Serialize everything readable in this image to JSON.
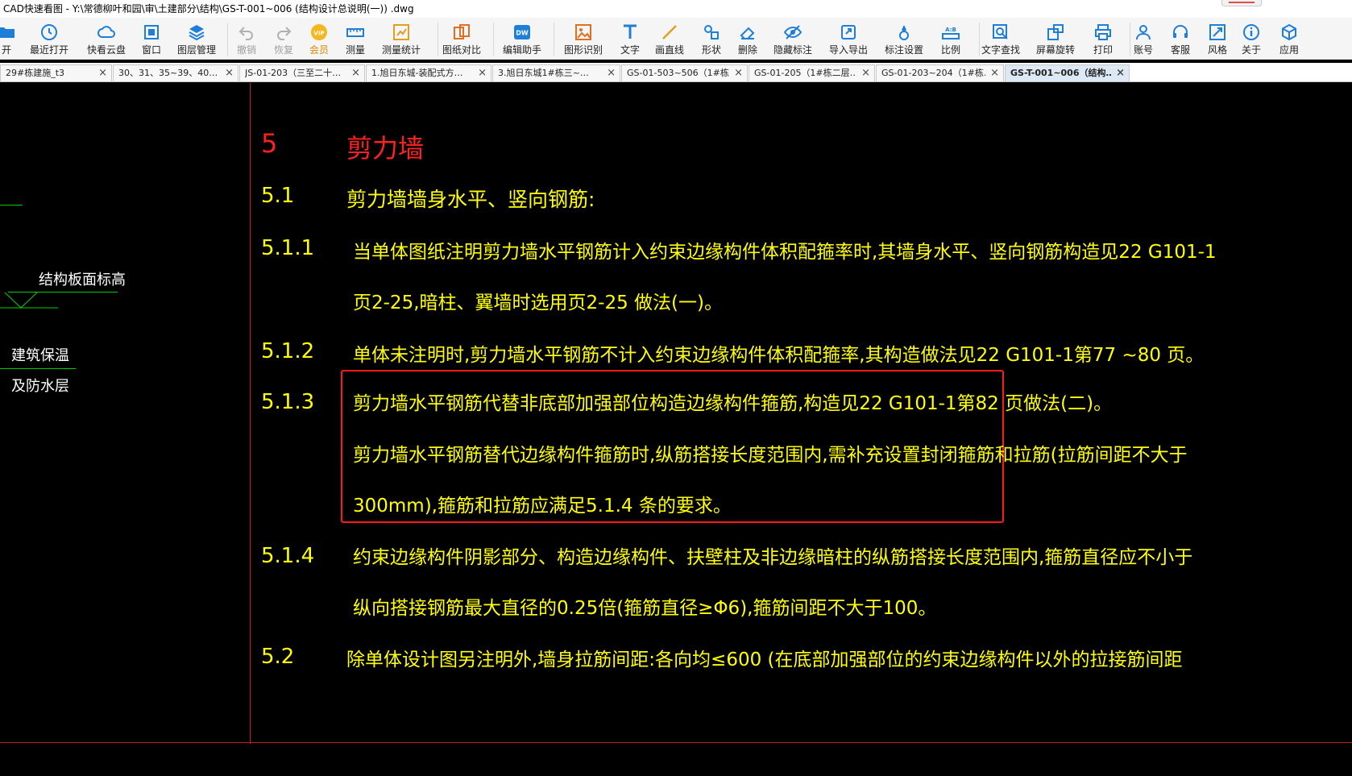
{
  "window": {
    "title": "CAD快速看图 - Y:\\常德柳叶和园\\审\\土建部分\\结构\\GS-T-001~006 (结构设计总说明(一)) .dwg"
  },
  "toolbar": {
    "items": [
      {
        "label": "开",
        "icon": "folder-open-icon"
      },
      {
        "label": "最近打开",
        "icon": "recent-clock-icon"
      },
      {
        "label": "快看云盘",
        "icon": "cloud-icon"
      },
      {
        "label": "窗口",
        "icon": "window-icon"
      },
      {
        "label": "图层管理",
        "icon": "layers-icon"
      },
      {
        "label": "撤销",
        "icon": "undo-icon"
      },
      {
        "label": "恢复",
        "icon": "redo-icon"
      },
      {
        "label": "会员",
        "icon": "vip-icon",
        "badge": "VIP"
      },
      {
        "label": "测量",
        "icon": "ruler-icon"
      },
      {
        "label": "测量统计",
        "icon": "measure-stats-icon"
      },
      {
        "label": "图纸对比",
        "icon": "compare-icon"
      },
      {
        "label": "编辑助手",
        "icon": "edit-assistant-icon",
        "badge": "DW"
      },
      {
        "label": "图形识别",
        "icon": "shape-recognition-icon"
      },
      {
        "label": "文字",
        "icon": "text-icon"
      },
      {
        "label": "画直线",
        "icon": "line-icon"
      },
      {
        "label": "形状",
        "icon": "shapes-icon"
      },
      {
        "label": "删除",
        "icon": "eraser-icon"
      },
      {
        "label": "隐藏标注",
        "icon": "hide-eye-icon"
      },
      {
        "label": "导入导出",
        "icon": "import-export-icon"
      },
      {
        "label": "标注设置",
        "icon": "annotation-settings-icon"
      },
      {
        "label": "比例",
        "icon": "scale-icon",
        "badge": "A:B"
      },
      {
        "label": "文字查找",
        "icon": "text-search-icon"
      },
      {
        "label": "屏幕旋转",
        "icon": "rotate-screen-icon"
      },
      {
        "label": "打印",
        "icon": "printer-icon"
      },
      {
        "label": "账号",
        "icon": "user-icon"
      },
      {
        "label": "客服",
        "icon": "headset-icon"
      },
      {
        "label": "风格",
        "icon": "style-icon"
      },
      {
        "label": "关于",
        "icon": "info-icon"
      },
      {
        "label": "应用",
        "icon": "apps-cube-icon"
      }
    ]
  },
  "tabs": [
    {
      "label": "29#栋建施_t3",
      "active": false
    },
    {
      "label": "30、31、35~39、40…",
      "active": false
    },
    {
      "label": "JS-01-203（三至二十…",
      "active": false
    },
    {
      "label": "1.旭日东城-装配式方…",
      "active": false
    },
    {
      "label": "3.旭日东城1#栋三~…",
      "active": false
    },
    {
      "label": "GS-01-503~506（1#栋…",
      "active": false
    },
    {
      "label": "GS-01-205（1#栋二层…",
      "active": false
    },
    {
      "label": "GS-01-203~204（1#栋…",
      "active": false
    },
    {
      "label": "GS-T-001~006（结构…",
      "active": true
    }
  ],
  "tab_close_glyph": "×",
  "drawing": {
    "left_notes": {
      "slab_level": "结构板面标高",
      "insulation_line1": "建筑保温",
      "insulation_line2": "及防水层"
    },
    "section": {
      "number": "5",
      "title": "剪力墙"
    },
    "items": [
      {
        "number": "5.1",
        "lines": [
          "剪力墙墙身水平、竖向钢筋:"
        ]
      },
      {
        "number": "5.1.1",
        "lines": [
          "当单体图纸注明剪力墙水平钢筋计入约束边缘构件体积配箍率时,其墙身水平、竖向钢筋构造见22 G101-1",
          "页2-25,暗柱、翼墙时选用页2-25 做法(一)。"
        ]
      },
      {
        "number": "5.1.2",
        "lines": [
          "单体未注明时,剪力墙水平钢筋不计入约束边缘构件体积配箍率,其构造做法见22 G101-1第77 ~80 页。"
        ]
      },
      {
        "number": "5.1.3",
        "lines": [
          "剪力墙水平钢筋代替非底部加强部位构造边缘构件箍筋,构造见22 G101-1第82 页做法(二)。",
          "剪力墙水平钢筋替代边缘构件箍筋时,纵筋搭接长度范围内,需补充设置封闭箍筋和拉筋(拉筋间距不大于",
          "300mm),箍筋和拉筋应满足5.1.4 条的要求。"
        ]
      },
      {
        "number": "5.1.4",
        "lines": [
          "约束边缘构件阴影部分、构造边缘构件、扶壁柱及非边缘暗柱的纵筋搭接长度范围内,箍筋直径应不小于",
          "纵向搭接钢筋最大直径的0.25倍(箍筋直径≥Φ6),箍筋间距不大于100。"
        ]
      },
      {
        "number": "5.2",
        "lines": [
          "除单体设计图另注明外,墙身拉筋间距:各向均≤600 (在底部加强部位的约束边缘构件以外的拉接筋间距"
        ]
      }
    ]
  },
  "colors": {
    "canvas_bg": "#000000",
    "number_color": "#ff2020",
    "text_color": "#ffff00",
    "frame_line": "#d01818",
    "highlight_box": "#ff1a1a",
    "leader_line": "#00d000"
  }
}
